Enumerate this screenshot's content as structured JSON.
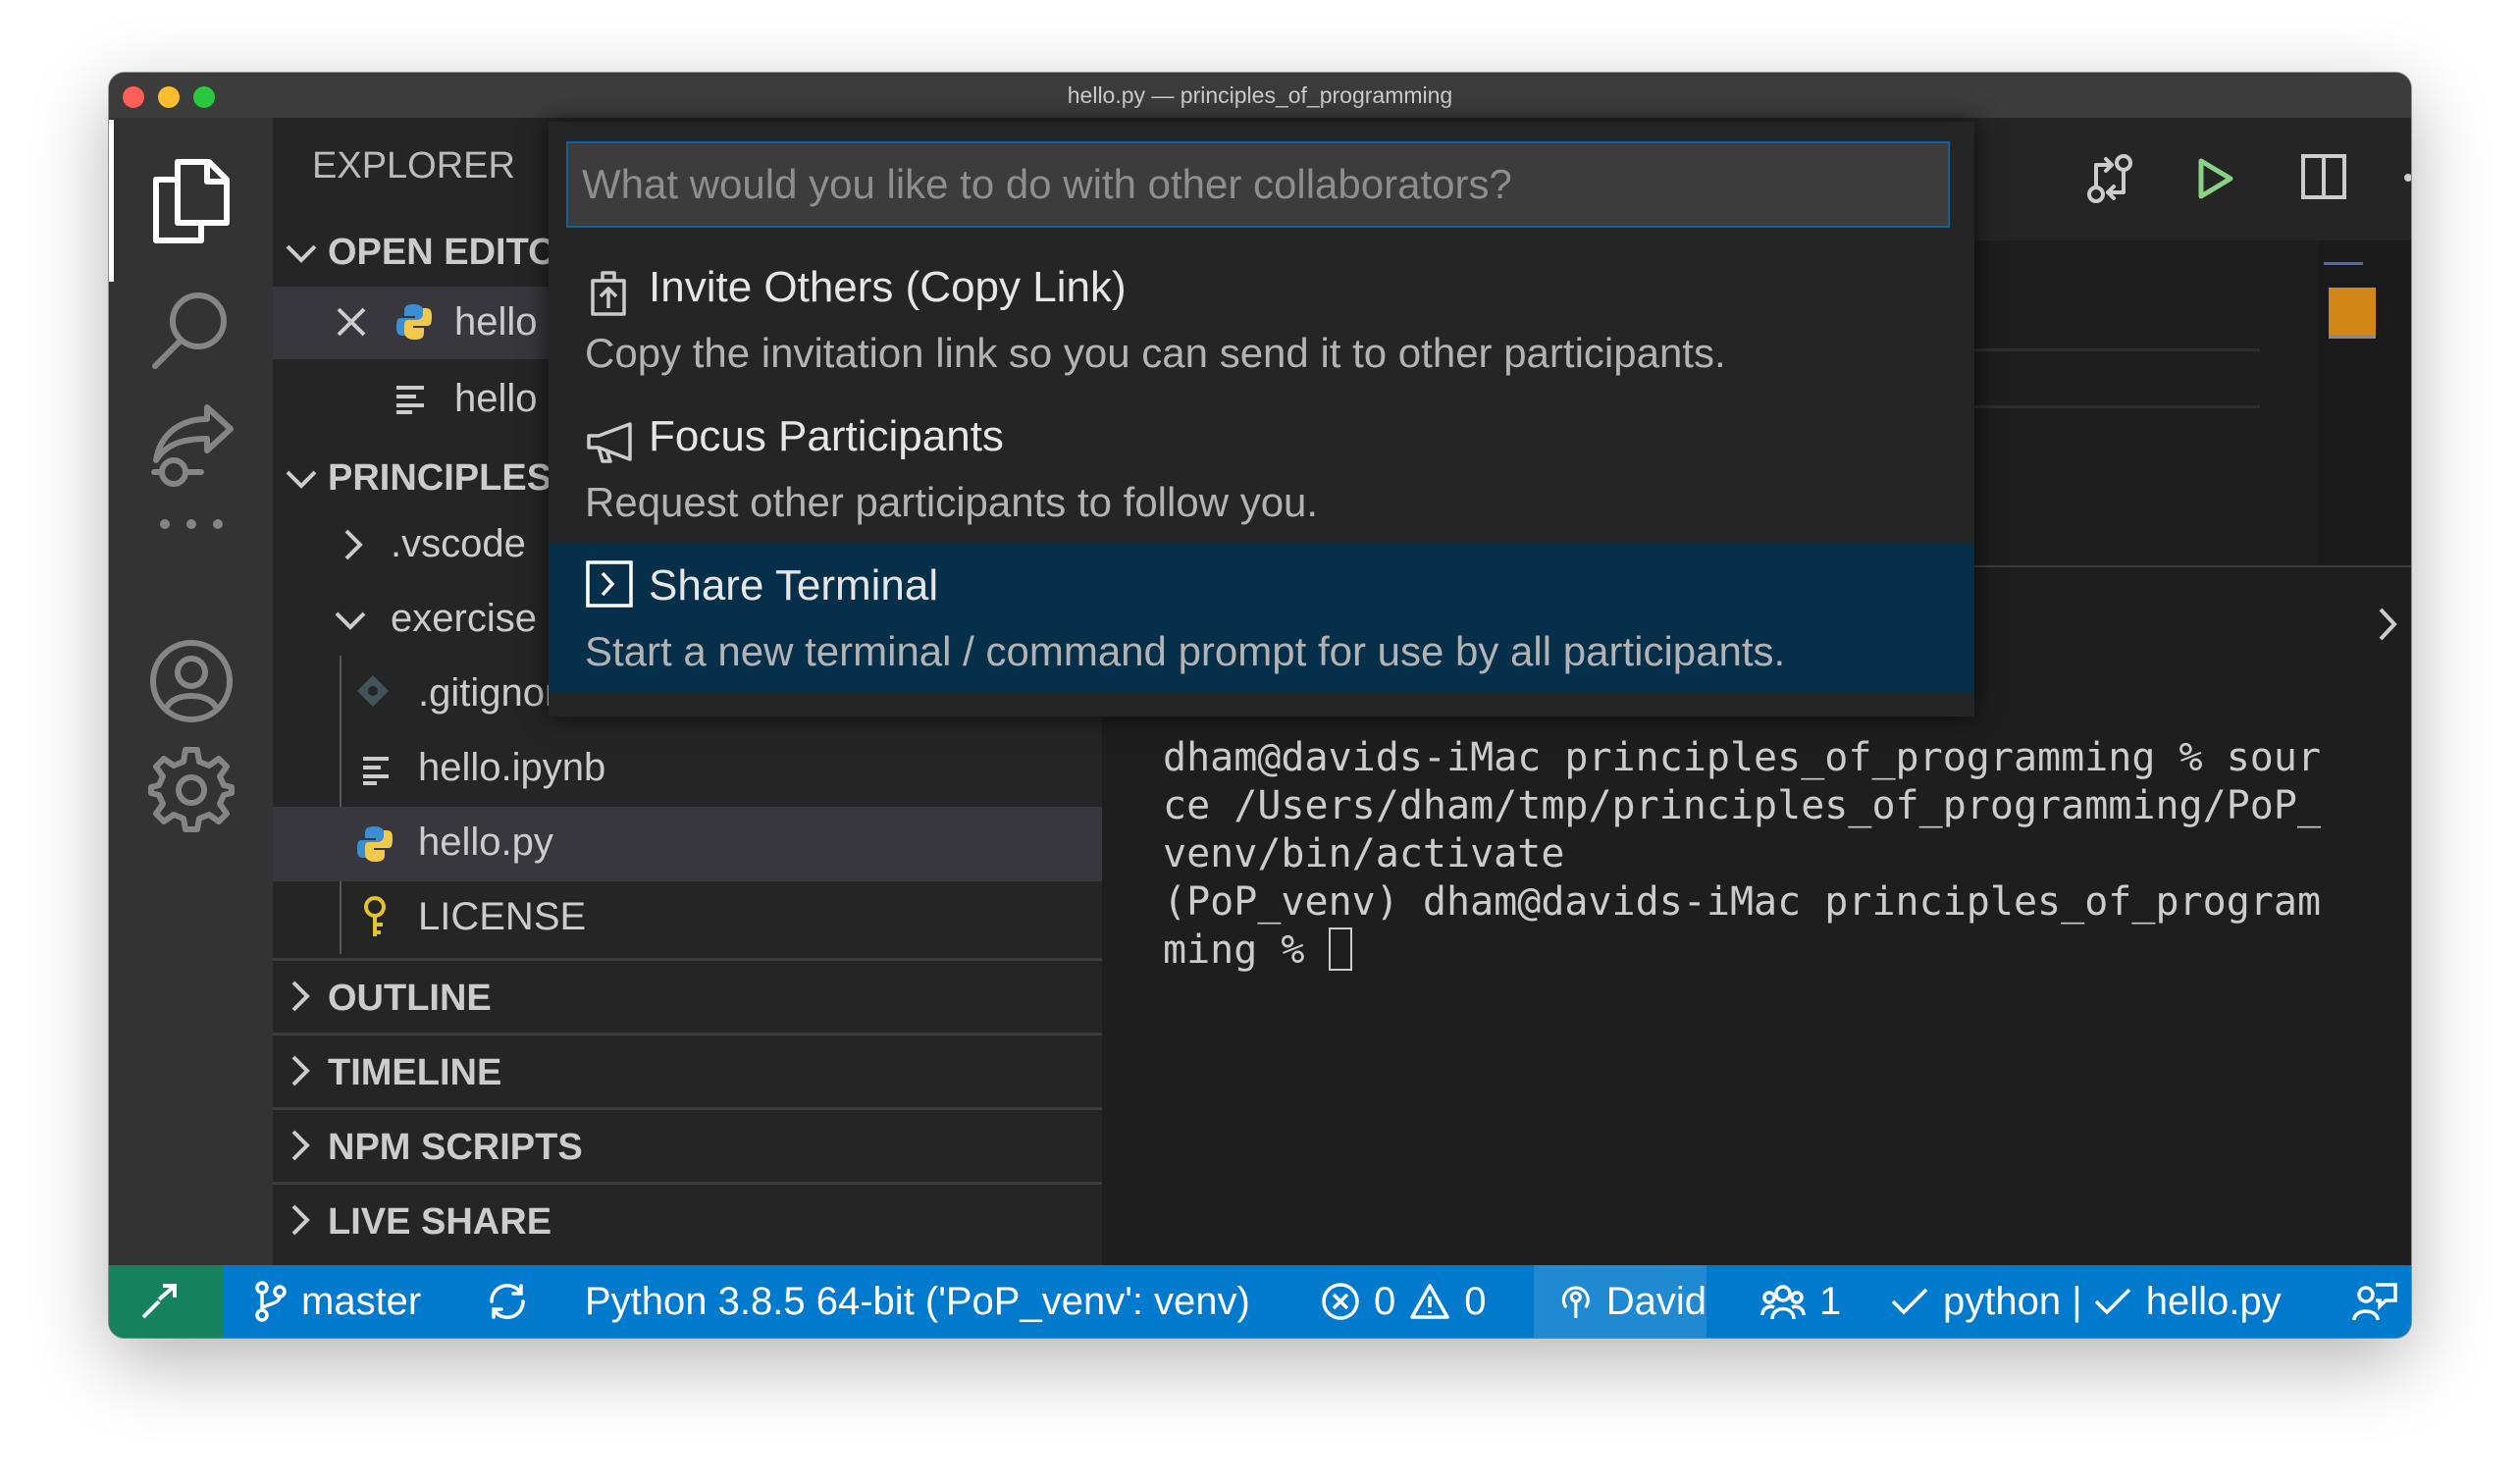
{
  "window": {
    "title": "hello.py — principles_of_programming"
  },
  "colors": {
    "accent": "#007acc",
    "remote_indicator": "#16825d",
    "selection": "#062f4a",
    "run_green": "#89d185",
    "traffic_close": "#ff5f57",
    "traffic_min": "#febc2e",
    "traffic_max": "#28c840"
  },
  "activity_bar": {
    "items": [
      "files-icon",
      "search-icon",
      "live-share-icon",
      "more-icon"
    ],
    "bottom": [
      "account-icon",
      "gear-icon"
    ]
  },
  "sidebar": {
    "title": "EXPLORER",
    "open_editors": {
      "header": "OPEN EDITO",
      "items": [
        {
          "label": "hello",
          "icon": "python-icon"
        },
        {
          "label": "hello",
          "icon": "notebook-icon"
        }
      ]
    },
    "project": {
      "header": "PRINCIPLES",
      "items": [
        {
          "label": ".vscode",
          "type": "folder"
        },
        {
          "label": "exercise",
          "type": "folder-open"
        },
        {
          "label": ".gitignore",
          "type": "file"
        },
        {
          "label": "hello.ipynb",
          "type": "file"
        },
        {
          "label": "hello.py",
          "type": "file"
        },
        {
          "label": "LICENSE",
          "type": "file"
        }
      ]
    },
    "sections": [
      "OUTLINE",
      "TIMELINE",
      "NPM SCRIPTS",
      "LIVE SHARE"
    ]
  },
  "quick_pick": {
    "placeholder": "What would you like to do with other collaborators?",
    "value": "",
    "items": [
      {
        "label": "Invite Others (Copy Link)",
        "description": "Copy the invitation link so you can send it to other participants.",
        "icon": "invite-icon"
      },
      {
        "label": "Focus Participants",
        "description": "Request other participants to follow you.",
        "icon": "megaphone-icon"
      },
      {
        "label": "Share Terminal",
        "description": "Start a new terminal / command prompt for use by all participants.",
        "icon": "terminal-icon"
      }
    ]
  },
  "terminal": {
    "lines": [
      "dham@davids-iMac principles_of_programming % sour",
      "ce /Users/dham/tmp/principles_of_programming/PoP_",
      "venv/bin/activate",
      "(PoP_venv) dham@davids-iMac principles_of_program",
      "ming % "
    ]
  },
  "status_bar": {
    "branch": "master",
    "interpreter": "Python 3.8.5 64-bit ('PoP_venv': venv)",
    "errors": "0",
    "warnings": "0",
    "live_share_user": "David",
    "participants": "1",
    "languages": "python | ",
    "file": "hello.py"
  }
}
